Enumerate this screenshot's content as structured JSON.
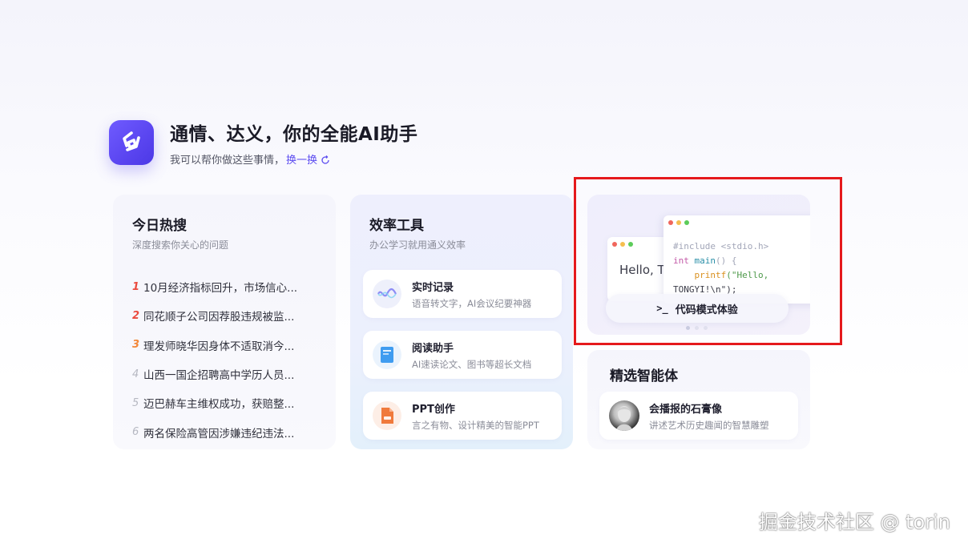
{
  "header": {
    "title": "通情、达义，你的全能AI助手",
    "subtitle": "我可以帮你做这些事情，",
    "swap_label": "换一换"
  },
  "hot_search": {
    "title": "今日热搜",
    "subtitle": "深度搜索你关心的问题",
    "items": [
      {
        "rank": "1",
        "text": "10月经济指标回升，市场信心..."
      },
      {
        "rank": "2",
        "text": "同花顺子公司因荐股违规被监..."
      },
      {
        "rank": "3",
        "text": "理发师晓华因身体不适取消今..."
      },
      {
        "rank": "4",
        "text": "山西一国企招聘高中学历人员..."
      },
      {
        "rank": "5",
        "text": "迈巴赫车主维权成功，获赔整..."
      },
      {
        "rank": "6",
        "text": "两名保险高管因涉嫌违纪违法..."
      }
    ]
  },
  "tools": {
    "title": "效率工具",
    "subtitle": "办公学习就用通义效率",
    "items": [
      {
        "name": "实时记录",
        "desc": "语音转文字，AI会议纪要神器",
        "icon": "wave-icon"
      },
      {
        "name": "阅读助手",
        "desc": "AI速读论文、图书等超长文档",
        "icon": "book-icon"
      },
      {
        "name": "PPT创作",
        "desc": "言之有物、设计精美的智能PPT",
        "icon": "ppt-icon"
      }
    ]
  },
  "code_card": {
    "hello_text": "Hello, T",
    "code_line1_pre": "#include <stdio.h>",
    "code_line2_kw": "int",
    "code_line2_fn": "main",
    "code_line2_rest": "() {",
    "code_line3_call": "printf",
    "code_line3_str": "(\"Hello,",
    "code_line4": "TONGYI!\\n\");",
    "button_prompt": ">_",
    "button_label": "代码模式体验",
    "pager_count": 3,
    "pager_active": 1
  },
  "agents": {
    "title": "精选智能体",
    "items": [
      {
        "name": "会播报的石膏像",
        "desc": "讲述艺术历史趣闻的智慧雕塑"
      }
    ]
  },
  "watermark": "掘金技术社区 @ torin",
  "colors": {
    "brand": "#5b4bf0",
    "highlight_box": "#e5191c",
    "rank_top": "#ea4a3e",
    "rank_third": "#f2883a"
  }
}
